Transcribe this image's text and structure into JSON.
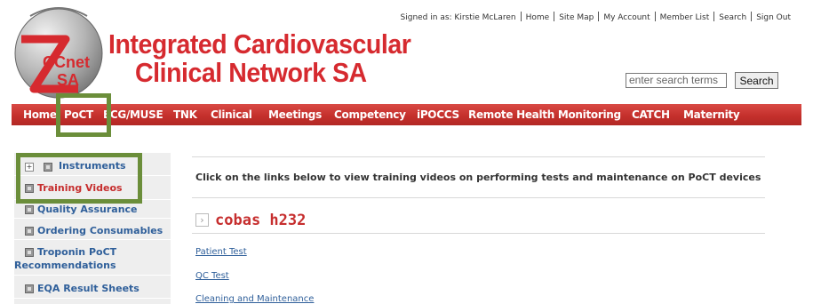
{
  "header": {
    "title_line1": "Integrated Cardiovascular",
    "title_line2": "Clinical Network SA",
    "logo_text_1": "CCnet",
    "logo_text_2": "SA"
  },
  "user_bar": {
    "signed_in": "Signed in as: Kirstie McLaren",
    "links": [
      "Home",
      "Site Map",
      "My Account",
      "Member List",
      "Search",
      "Sign Out"
    ]
  },
  "search": {
    "placeholder": "enter search terms",
    "button_label": "Search"
  },
  "nav": {
    "items": [
      "Home",
      "PoCT",
      "ECG/MUSE",
      "TNK",
      "Clinical",
      "Meetings",
      "Competency",
      "iPOCCS",
      "Remote Health Monitoring",
      "CATCH",
      "Maternity"
    ],
    "active": "PoCT"
  },
  "sidebar": {
    "items": [
      {
        "label": "Instruments",
        "expandable": true
      },
      {
        "label": "Training Videos",
        "active": true
      },
      {
        "label": "Quality Assurance"
      },
      {
        "label": "Ordering Consumables"
      },
      {
        "label_line1": "Troponin PoCT",
        "label_line2": "Recommendations"
      },
      {
        "label": "EQA Result Sheets"
      }
    ]
  },
  "main": {
    "intro": "Click on the links below to view training videos on performing tests and maintenance on PoCT devices",
    "section_title": "cobas h232",
    "links": [
      "Patient Test",
      "QC Test",
      "Cleaning and Maintenance"
    ]
  },
  "colors": {
    "brand_red": "#d62a2f",
    "nav_red": "#c5302c",
    "link_blue": "#2f5f9a",
    "highlight_green": "#6b8e3a"
  }
}
